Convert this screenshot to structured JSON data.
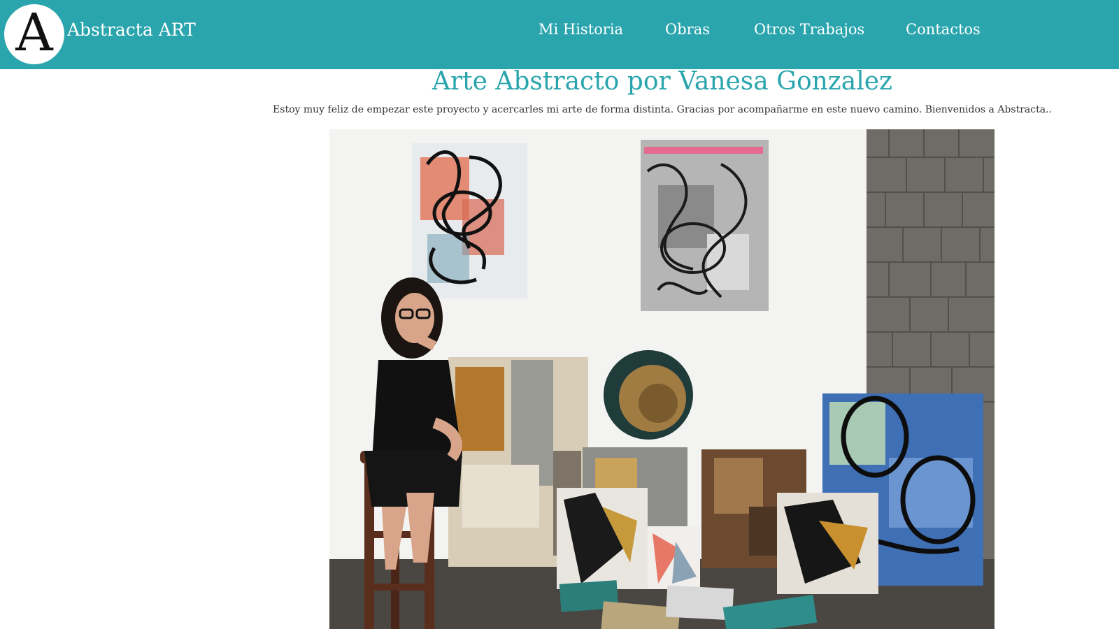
{
  "header": {
    "logo_letter": "A",
    "brand": "Abstracta ART",
    "nav": [
      {
        "label": "Mi Historia"
      },
      {
        "label": "Obras"
      },
      {
        "label": "Otros Trabajos"
      },
      {
        "label": "Contactos"
      }
    ]
  },
  "main": {
    "title": "Arte Abstracto por Vanesa Gonzalez",
    "intro": "Estoy muy feliz de empezar este proyecto y acercarles mi arte de forma distinta. Gracias por acompañarme en este nuevo camino. Bienvenidos a Abstracta.."
  },
  "colors": {
    "header_bg": "#2aa5ad",
    "title": "#2aa5ad"
  },
  "icons": {
    "logo": "letter-a-logo-icon"
  }
}
